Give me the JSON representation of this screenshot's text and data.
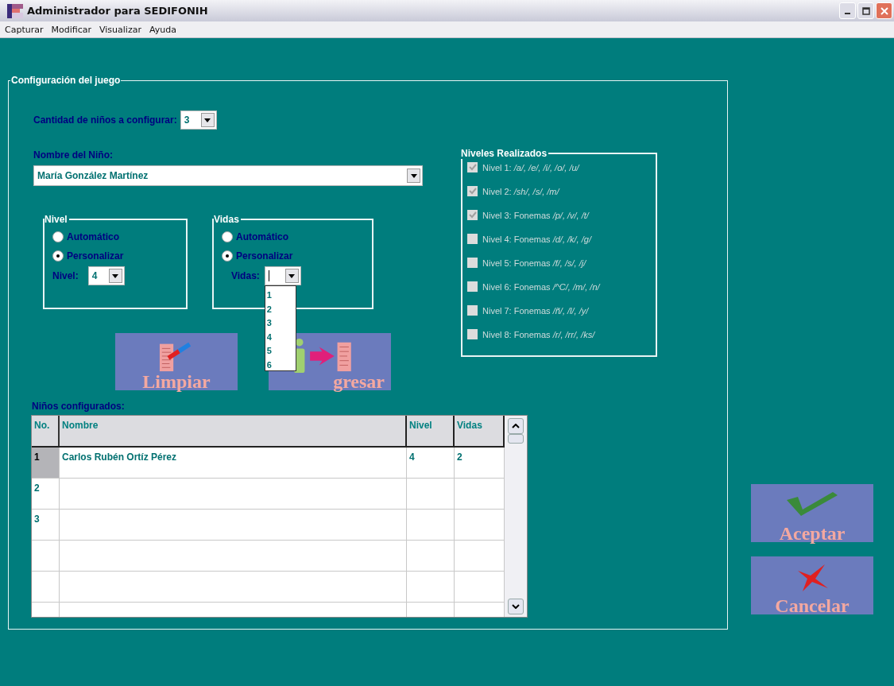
{
  "window": {
    "title": "Administrador para SEDIFONIH"
  },
  "menu": [
    "Capturar",
    "Modificar",
    "Visualizar",
    "Ayuda"
  ],
  "config": {
    "title": "Configuración del juego",
    "count": {
      "label": "Cantidad de niños a configurar:",
      "value": "3"
    },
    "child_name": {
      "label": "Nombre del Niño:",
      "value": "María González Martínez"
    },
    "nivel": {
      "title": "Nivel",
      "options": [
        {
          "label": "Automático",
          "selected": false
        },
        {
          "label": "Personalizar",
          "selected": true
        }
      ],
      "field_label": "Nivel:",
      "value": "4"
    },
    "vidas": {
      "title": "Vidas",
      "options": [
        {
          "label": "Automático",
          "selected": false
        },
        {
          "label": "Personalizar",
          "selected": true
        }
      ],
      "field_label": "Vidas:",
      "dropdown_options": [
        "1",
        "2",
        "3",
        "4",
        "5",
        "6"
      ]
    },
    "buttons": [
      {
        "label": "Limpiar",
        "kind": "clear"
      },
      {
        "label": "gresar",
        "kind": "enter"
      }
    ],
    "levels": {
      "title": "Niveles Realizados",
      "items": [
        {
          "label": "Nivel 1: */a/, /e/, /i/, /o/, /u/*",
          "checked": true,
          "disabled": true
        },
        {
          "label": "Nivel 2: */sh/, /s/, /m/*",
          "checked": true,
          "disabled": true
        },
        {
          "label": "Nivel 3: Fonemas */p/, /v/, /t/*",
          "checked": true,
          "disabled": true
        },
        {
          "label": "Nivel 4: Fonemas */d/, /k/, /g/*",
          "checked": false,
          "disabled": true
        },
        {
          "label": "Nivel 5: Fonemas */f/, /s/, /j/*",
          "checked": false,
          "disabled": true
        },
        {
          "label": "Nivel 6: Fonemas */^C/, /m/, /n/*",
          "checked": false,
          "disabled": true
        },
        {
          "label": "Nivel 7: Fonemas */ñ/, /l/, /y/*",
          "checked": false,
          "disabled": true
        },
        {
          "label": "Nivel 8: Fonemas */r/, /rr/, /ks/*",
          "checked": false,
          "disabled": true
        }
      ]
    },
    "table": {
      "label": "Niños configurados:",
      "columns": [
        "No.",
        "Nombre",
        "Nivel",
        "Vidas"
      ],
      "rows": [
        {
          "no": "1",
          "name": "Carlos Rubén Ortíz Pérez",
          "nivel": "4",
          "vidas": "2",
          "selected": true
        },
        {
          "no": "2",
          "selected": false
        },
        {
          "no": "3",
          "selected": false
        }
      ]
    }
  },
  "actions": [
    {
      "label": "Aceptar",
      "kind": "accept"
    },
    {
      "label": "Cancelar",
      "kind": "cancel"
    }
  ]
}
